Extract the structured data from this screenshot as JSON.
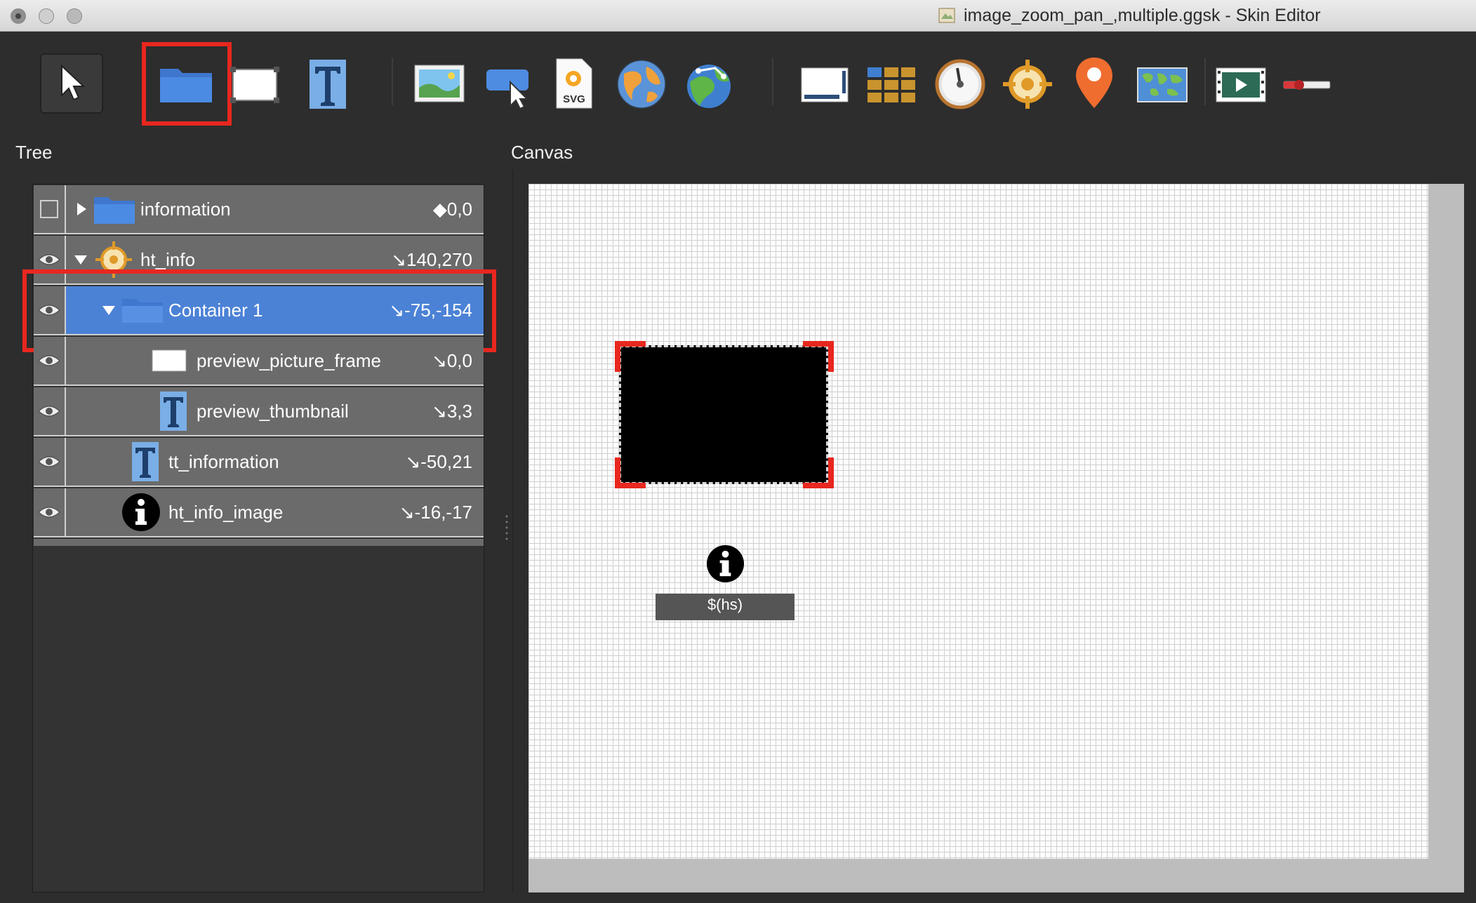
{
  "window": {
    "title": "image_zoom_pan_,multiple.ggsk - Skin Editor"
  },
  "toolbar": {
    "tools": [
      {
        "name": "select-tool-button",
        "icon": "arrow-cursor-icon"
      },
      {
        "name": "container-tool-button",
        "icon": "folder-icon",
        "highlighted": true
      },
      {
        "name": "rectangle-tool-button",
        "icon": "rectangle-icon"
      },
      {
        "name": "text-tool-button",
        "icon": "text-t-icon"
      },
      {
        "name": "image-tool-button",
        "icon": "image-icon"
      },
      {
        "name": "button-tool-button",
        "icon": "button-cursor-icon"
      },
      {
        "name": "svg-tool-button",
        "icon": "svg-icon",
        "label": "SVG"
      },
      {
        "name": "map-tool-button",
        "icon": "globe-icon"
      },
      {
        "name": "map-pin-globe-tool-button",
        "icon": "globe-pin-icon"
      },
      {
        "name": "scrollarea-tool-button",
        "icon": "scrollarea-icon"
      },
      {
        "name": "cloner-tool-button",
        "icon": "grid-cloner-icon"
      },
      {
        "name": "timer-tool-button",
        "icon": "dial-icon"
      },
      {
        "name": "hotspot-tool-button",
        "icon": "crosshair-icon"
      },
      {
        "name": "marker-tool-button",
        "icon": "map-marker-icon"
      },
      {
        "name": "floorplan-tool-button",
        "icon": "world-map-icon"
      },
      {
        "name": "video-tool-button",
        "icon": "video-icon"
      },
      {
        "name": "slider-tool-button",
        "icon": "slider-icon"
      }
    ]
  },
  "tree": {
    "heading": "Tree",
    "rows": [
      {
        "label": "information",
        "position": "◆0,0",
        "icon": "folder-icon",
        "visible": false,
        "expander": "collapsed"
      },
      {
        "label": "ht_info",
        "position": "↘140,270",
        "icon": "crosshair-icon",
        "visible": true,
        "expander": "expanded"
      },
      {
        "label": "Container 1",
        "position": "↘-75,-154",
        "icon": "folder-icon",
        "visible": true,
        "expander": "expanded",
        "selected": true
      },
      {
        "label": "preview_picture_frame",
        "position": "↘0,0",
        "icon": "rectangle-icon",
        "visible": true
      },
      {
        "label": "preview_thumbnail",
        "position": "↘3,3",
        "icon": "text-t-icon",
        "visible": true
      },
      {
        "label": "tt_information",
        "position": "↘-50,21",
        "icon": "text-t-icon",
        "visible": true
      },
      {
        "label": "ht_info_image",
        "position": "↘-16,-17",
        "icon": "info-icon",
        "visible": true
      }
    ]
  },
  "canvas": {
    "heading": "Canvas",
    "hotspot_label": "$(hs)"
  },
  "colors": {
    "accent_highlight": "#e8271f",
    "selection_blue": "#4b82d6",
    "folder_blue": "#4a86e0",
    "text_tool_blue": "#7aaee6"
  }
}
